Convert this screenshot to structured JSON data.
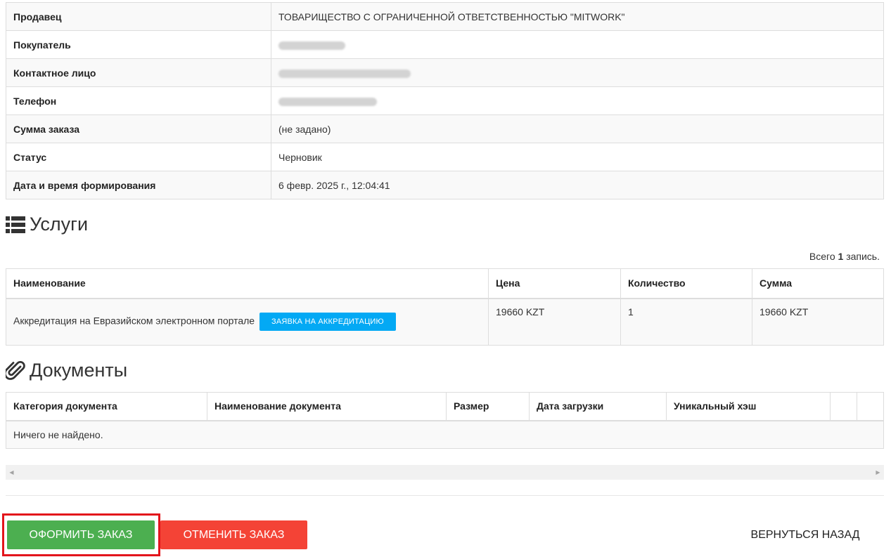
{
  "details": [
    {
      "label": "Продавец",
      "value": "ТОВАРИЩЕСТВО С ОГРАНИЧЕННОЙ ОТВЕТСТВЕННОСТЬЮ \"MITWORK\""
    },
    {
      "label": "Покупатель",
      "value": ""
    },
    {
      "label": "Контактное лицо",
      "value": ""
    },
    {
      "label": "Телефон",
      "value": ""
    },
    {
      "label": "Сумма заказа",
      "value": "(не задано)"
    },
    {
      "label": "Статус",
      "value": "Черновик"
    },
    {
      "label": "Дата и время формирования",
      "value": "6 февр. 2025 г., 12:04:41"
    }
  ],
  "services": {
    "title": "Услуги",
    "summary_prefix": "Всего",
    "summary_count": "1",
    "summary_suffix": "запись.",
    "headers": [
      "Наименование",
      "Цена",
      "Количество",
      "Сумма"
    ],
    "rows": [
      {
        "name": "Аккредитация на Евразийском электронном портале",
        "action_label": "Заявка на аккредитацию",
        "price": "19660 KZT",
        "quantity": "1",
        "sum": "19660 KZT"
      }
    ]
  },
  "documents": {
    "title": "Документы",
    "headers": [
      "Категория документа",
      "Наименование документа",
      "Размер",
      "Дата загрузки",
      "Уникальный хэш"
    ],
    "empty_text": "Ничего не найдено."
  },
  "actions": {
    "submit_label": "Оформить заказ",
    "cancel_label": "Отменить заказ",
    "back_label": "Вернуться назад"
  },
  "icons": {
    "services": "list-icon",
    "documents": "paperclip-icon"
  },
  "colors": {
    "submit": "#4caf50",
    "cancel": "#f44336",
    "accent": "#03a9f4",
    "highlight": "#e3141b"
  }
}
